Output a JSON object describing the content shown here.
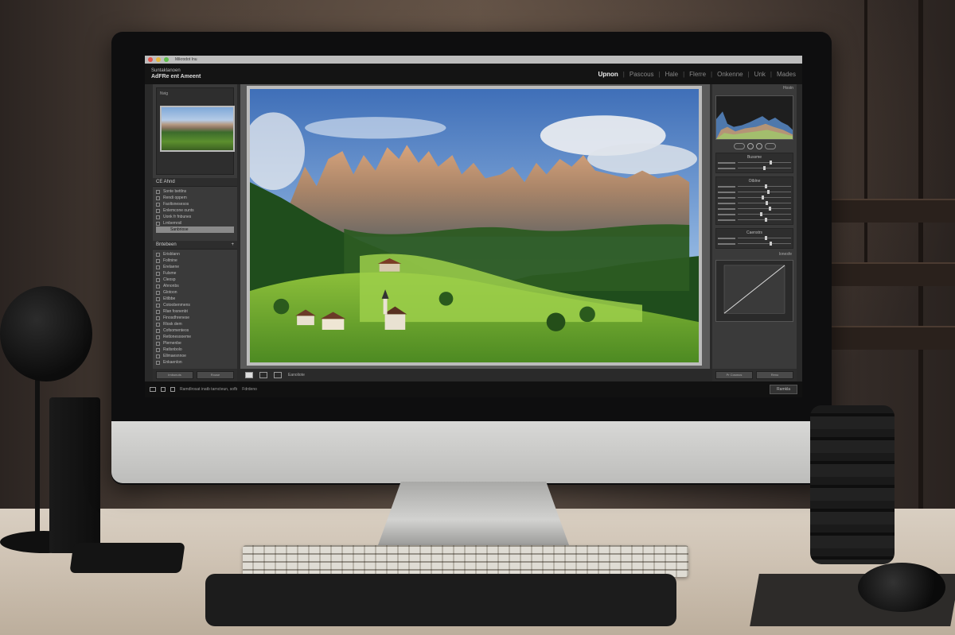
{
  "titlebar": {
    "text": "Mikrodot Inu"
  },
  "header": {
    "brand_line1": "Suntaklanoen",
    "brand_line2": "AdFRe ent Ameent",
    "modules": [
      {
        "label": "Upnon",
        "active": true
      },
      {
        "label": "Pascous",
        "active": false
      },
      {
        "label": "Hale",
        "active": false
      },
      {
        "label": "Flerre",
        "active": false
      },
      {
        "label": "Onkenne",
        "active": false
      },
      {
        "label": "Unk",
        "active": false
      },
      {
        "label": "Mades",
        "active": false
      }
    ]
  },
  "left_panel": {
    "navigator_label": "Nvig",
    "collections_title": "CE Ahnd",
    "collections": [
      "Sonte bettlns",
      "Rendi oppem",
      "Faoltsnesesos",
      "Enlemcone ounts",
      "Uonk fr fnbunes",
      "Lrnbemrsil"
    ],
    "selected_collection": "Sanbriose",
    "folders_title": "Bntebeen",
    "folders": [
      "Erisblann",
      "Foltnine",
      "Erelaene",
      "Fulsme",
      "Cleosp",
      "Ahnonbs",
      "Glotoon",
      "Eltlbbe",
      "Cotoobenmens",
      "Rlan fosnenbt",
      "Finosdhrenese",
      "Rlosk dem",
      "Cofsomenteos",
      "Retlonesooeme",
      "Plernenbe",
      "Ratlsnbolo",
      "Ellmaesnnoe",
      "Enkaenlon"
    ],
    "import_label": "Imbunuts",
    "export_label": "Rouse"
  },
  "center": {
    "toolstrip_label": "Eanoliote"
  },
  "right_panel": {
    "histogram_label": "Hostn",
    "basic_label": "Bussme",
    "tone_label": "Otblne",
    "presence_label": "Caenstrs",
    "curve_label": "Ionesfe",
    "prev_label": "Pr Cosmos",
    "reset_label": "Reno"
  },
  "status": {
    "text": "Ramdlrosat inatb tarncteun, sofb",
    "extra": "Fdrdeno",
    "filter_label": "Ramkla"
  },
  "colors": {
    "close": "#e5544b",
    "minimize": "#e6b740",
    "maximize": "#5fbe4c"
  }
}
